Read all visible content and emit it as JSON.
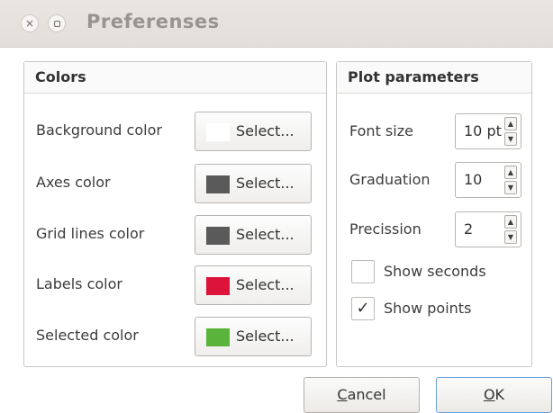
{
  "window": {
    "title": "Preferenses",
    "close_glyph": "×"
  },
  "colors": {
    "title": "Colors",
    "rows": [
      {
        "label": "Background color",
        "button": "Select...",
        "swatch": "#ffffff"
      },
      {
        "label": "Axes color",
        "button": "Select...",
        "swatch": "#5a5a5a"
      },
      {
        "label": "Grid lines color",
        "button": "Select...",
        "swatch": "#5a5a5a"
      },
      {
        "label": "Labels color",
        "button": "Select...",
        "swatch": "#dc143c"
      },
      {
        "label": "Selected color",
        "button": "Select...",
        "swatch": "#5ab33a"
      }
    ]
  },
  "plot": {
    "title": "Plot parameters",
    "font_size": {
      "label": "Font size",
      "value": "10 pt"
    },
    "graduation": {
      "label": "Graduation",
      "value": "10"
    },
    "precission": {
      "label": "Precission",
      "value": "2"
    },
    "show_seconds": {
      "label": "Show seconds",
      "checked": false,
      "mark": ""
    },
    "show_points": {
      "label": "Show points",
      "checked": true,
      "mark": "✓"
    }
  },
  "buttons": {
    "cancel_first": "C",
    "cancel_rest": "ancel",
    "ok_first": "O",
    "ok_rest": "K"
  }
}
